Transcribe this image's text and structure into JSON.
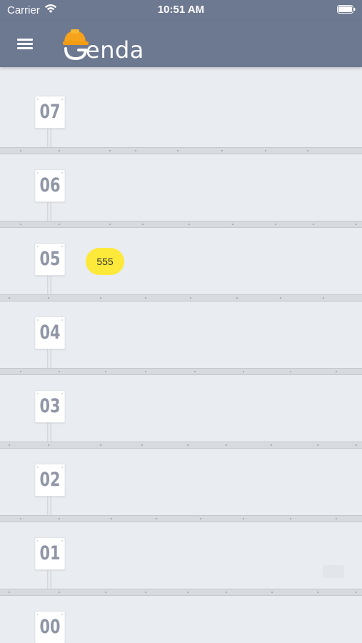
{
  "status_bar": {
    "carrier": "Carrier",
    "time": "10:51 AM",
    "icons": [
      "wifi-icon",
      "battery-icon"
    ]
  },
  "nav": {
    "menu_icon": "hamburger-menu-icon",
    "logo_text": "enda",
    "logo_icon": "hardhat-icon",
    "logo_accent_color": "#f6a21a",
    "bar_color": "#6d7891"
  },
  "floors": [
    {
      "label": "07"
    },
    {
      "label": "06"
    },
    {
      "label": "05",
      "badge": "555"
    },
    {
      "label": "04"
    },
    {
      "label": "03"
    },
    {
      "label": "02"
    },
    {
      "label": "01"
    },
    {
      "label": "00"
    }
  ],
  "colors": {
    "background": "#e9ecf1",
    "badge": "#fde93a",
    "sign_text": "#8f96a6"
  }
}
